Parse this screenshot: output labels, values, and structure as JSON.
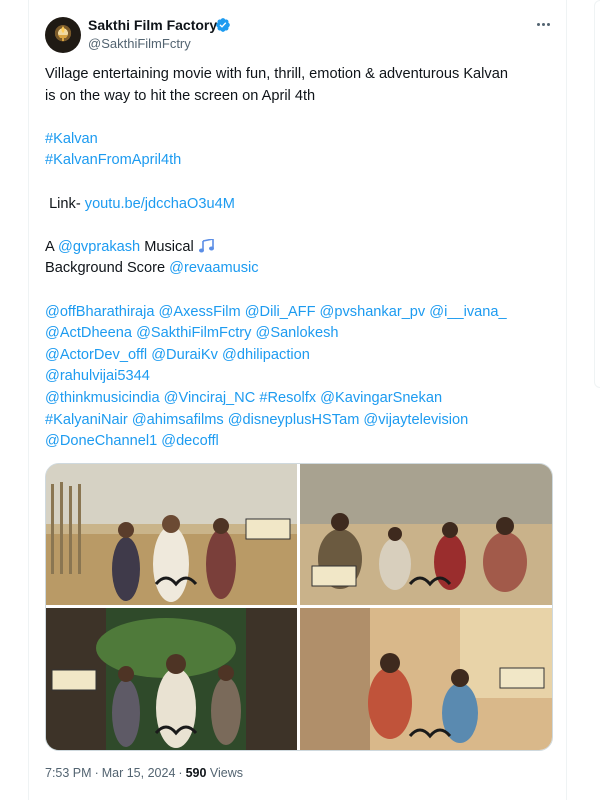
{
  "tweet": {
    "author_name": "Sakthi Film Factory",
    "handle": "@SakthiFilmFctry",
    "lines": [
      "Village entertaining movie with fun, thrill, emotion & adventurous Kalvan",
      "is on the way to hit the screen on April 4th"
    ],
    "hashtags": [
      "#Kalvan",
      "#KalvanFromApril4th"
    ],
    "link_prefix": "Link-",
    "link": "youtu.be/jdcchaO3u4M",
    "musical_prefix": "A",
    "musical_mention": "@gvprakash",
    "musical_suffix": "Musical",
    "bgscore_label": "Background Score",
    "bgscore_mention": "@revaamusic",
    "tags_rows": [
      [
        "@offBharathiraja",
        "@AxessFilm",
        "@Dili_AFF",
        "@pvshankar_pv",
        "@i__ivana_"
      ],
      [
        "@ActDheena",
        "@SakthiFilmFctry",
        "@Sanlokesh"
      ],
      [
        "@ActorDev_offl",
        "@DuraiKv",
        "@dhilipaction"
      ],
      [
        "@rahulvijai5344"
      ],
      [
        "@thinkmusicindia",
        "@Vinciraj_NC",
        "#Resolfx",
        "@KavingarSnekan"
      ],
      [
        "#KalyaniNair",
        "@ahimsafilms",
        " @disneyplusHSTam",
        "@vijaytelevision"
      ],
      [
        "@DoneChannel1",
        "@decoffl"
      ]
    ],
    "time": "7:53 PM",
    "date": "Mar 15, 2024",
    "views_count": "590",
    "views_label": "Views"
  },
  "icons": {
    "avatar": "film-lamp-logo",
    "verified": "verified-badge-icon",
    "more": "more-options-icon",
    "music": "music-notes-icon"
  },
  "colors": {
    "link": "#1d9bf0",
    "secondary_text": "#536471",
    "primary_text": "#0f1419",
    "verified": "#1d9bf0"
  }
}
